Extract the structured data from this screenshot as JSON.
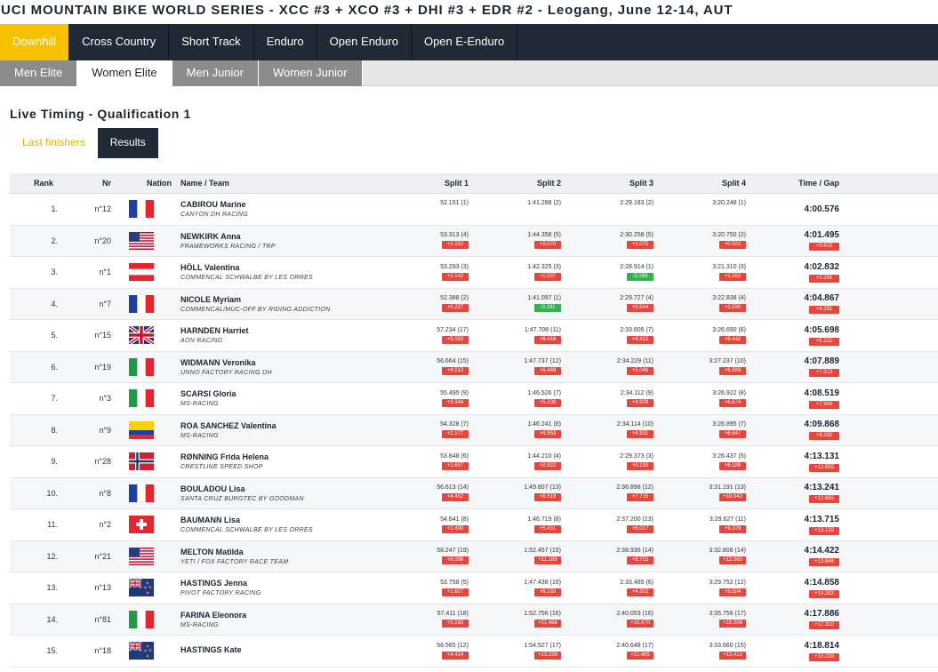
{
  "event_title": "UCI MOUNTAIN BIKE WORLD SERIES - XCC #3 + XCO #3 + DHI #3 + EDR #2 - Leogang, June 12-14, AUT",
  "discipline_tabs": [
    "Downhill",
    "Cross Country",
    "Short Track",
    "Enduro",
    "Open Enduro",
    "Open E-Enduro"
  ],
  "category_tabs": [
    "Men Elite",
    "Women Elite",
    "Men Junior",
    "Women Junior"
  ],
  "section_title": "Live Timing - Qualification 1",
  "sub_tabs": [
    "Last finishers",
    "Results"
  ],
  "table_headers": {
    "rank": "Rank",
    "nr": "Nr",
    "nation": "Nation",
    "name": "Name / Team",
    "split1": "Split 1",
    "split2": "Split 2",
    "split3": "Split 3",
    "split4": "Split 4",
    "time": "Time / Gap"
  },
  "colors": {
    "accent": "#f6c200",
    "nav_dark": "#1f2a36",
    "gap_red": "#e8453c",
    "gap_green": "#2fb34a"
  },
  "riders": [
    {
      "rank": "1.",
      "nr": "n°12",
      "nation": "FRA",
      "name": "CABIROU Marine",
      "team": "CANYON DH RACING",
      "s1": "52.151 (1)",
      "g1": "",
      "s2": "1:41.288 (2)",
      "g2": "",
      "s3": "2:29.183 (2)",
      "g3": "",
      "s4": "3:20.248 (1)",
      "g4": "",
      "time": "4:00.576",
      "gap": ""
    },
    {
      "rank": "2.",
      "nr": "n°20",
      "nation": "USA",
      "name": "NEWKIRK Anna",
      "team": "FRAMEWORKS RACING / TRP",
      "s1": "53.313 (4)",
      "g1": "+1.162",
      "s2": "1:44.358 (5)",
      "g2": "+3.070",
      "s3": "2:30.258 (5)",
      "g3": "+1.075",
      "s4": "3:20.750 (2)",
      "g4": "+0.502",
      "time": "4:01.495",
      "gap": "+0.919"
    },
    {
      "rank": "3.",
      "nr": "n°1",
      "nation": "AUT",
      "name": "HÖLL Valentina",
      "team": "COMMENCAL SCHWALBE BY LES ORRES",
      "s1": "53.293 (3)",
      "g1": "+1.142",
      "s2": "1:42.325 (3)",
      "g2": "+1.037",
      "s3": "2:28.914 (1)",
      "g3": "-0.269",
      "s4": "3:21.310 (3)",
      "g4": "+1.062",
      "time": "4:02.832",
      "gap": "+2.256"
    },
    {
      "rank": "4.",
      "nr": "n°7",
      "nation": "FRA",
      "name": "NICOLE Myriam",
      "team": "COMMENCAL/MUC-OFF BY RIDING ADDICTION",
      "s1": "52.388 (2)",
      "g1": "+0.237",
      "s2": "1:41.097 (1)",
      "g2": "-0.191",
      "s3": "2:29.727 (4)",
      "g3": "+0.544",
      "s4": "3:22.838 (4)",
      "g4": "+2.590",
      "time": "4:04.867",
      "gap": "+4.291"
    },
    {
      "rank": "5.",
      "nr": "n°15",
      "nation": "GBR",
      "name": "HARNDEN Harriet",
      "team": "AON RACING",
      "s1": "57.234 (17)",
      "g1": "+5.083",
      "s2": "1:47.706 (11)",
      "g2": "+6.418",
      "s3": "2:33.605 (7)",
      "g3": "+4.422",
      "s4": "3:26.690 (6)",
      "g4": "+6.442",
      "time": "4:05.698",
      "gap": "+5.122"
    },
    {
      "rank": "6.",
      "nr": "n°19",
      "nation": "ITA",
      "name": "WIDMANN Veronika",
      "team": "UNNO FACTORY RACING DH",
      "s1": "56.664 (15)",
      "g1": "+4.513",
      "s2": "1:47.737 (12)",
      "g2": "+6.449",
      "s3": "2:34.229 (11)",
      "g3": "+5.046",
      "s4": "3:27.237 (10)",
      "g4": "+6.989",
      "time": "4:07.889",
      "gap": "+7.313"
    },
    {
      "rank": "7.",
      "nr": "n°3",
      "nation": "ITA",
      "name": "SCARSI Gloria",
      "team": "MS-RACING",
      "s1": "55.495 (9)",
      "g1": "+3.344",
      "s2": "1:46.526 (7)",
      "g2": "+5.238",
      "s3": "2:34.112 (9)",
      "g3": "+4.929",
      "s4": "3:26.922 (8)",
      "g4": "+6.674",
      "time": "4:08.519",
      "gap": "+7.943"
    },
    {
      "rank": "8.",
      "nr": "n°9",
      "nation": "COL",
      "name": "ROA SANCHEZ Valentina",
      "team": "MS-RACING",
      "s1": "54.328 (7)",
      "g1": "+2.177",
      "s2": "1:46.241 (6)",
      "g2": "+4.953",
      "s3": "2:34.114 (10)",
      "g3": "+4.931",
      "s4": "3:26.895 (7)",
      "g4": "+6.647",
      "time": "4:09.868",
      "gap": "+9.292"
    },
    {
      "rank": "9.",
      "nr": "n°28",
      "nation": "NOR",
      "name": "RØNNING Frida Helena",
      "team": "CRESTLINE SPEED SHOP",
      "s1": "53.848 (6)",
      "g1": "+1.697",
      "s2": "1:44.210 (4)",
      "g2": "+2.922",
      "s3": "2:29.373 (3)",
      "g3": "+0.190",
      "s4": "3:26.437 (5)",
      "g4": "+6.189",
      "time": "4:13.131",
      "gap": "+12.555"
    },
    {
      "rank": "10.",
      "nr": "n°8",
      "nation": "FRA",
      "name": "BOULADOU Lisa",
      "team": "SANTA CRUZ BURGTEC BY GOODMAN",
      "s1": "56.613 (14)",
      "g1": "+4.462",
      "s2": "1:49.807 (13)",
      "g2": "+8.519",
      "s3": "2:36.898 (12)",
      "g3": "+7.715",
      "s4": "3:31.191 (13)",
      "g4": "+10.943",
      "time": "4:13.241",
      "gap": "+12.665"
    },
    {
      "rank": "11.",
      "nr": "n°2",
      "nation": "SUI",
      "name": "BAUMANN Lisa",
      "team": "COMMENCAL SCHWALBE BY LES ORRES",
      "s1": "54.641 (8)",
      "g1": "+2.490",
      "s2": "1:46.719 (8)",
      "g2": "+5.431",
      "s3": "2:37.200 (13)",
      "g3": "+8.017",
      "s4": "3:29.627 (11)",
      "g4": "+9.379",
      "time": "4:13.715",
      "gap": "+13.139"
    },
    {
      "rank": "12.",
      "nr": "n°21",
      "nation": "USA",
      "name": "MELTON Matilda",
      "team": "YETI / FOX FACTORY RACE TEAM",
      "s1": "58.247 (19)",
      "g1": "+6.096",
      "s2": "1:52.457 (15)",
      "g2": "+11.169",
      "s3": "2:38.936 (14)",
      "g3": "+9.753",
      "s4": "3:32.808 (14)",
      "g4": "+12.560",
      "time": "4:14.422",
      "gap": "+13.846"
    },
    {
      "rank": "13.",
      "nr": "n°13",
      "nation": "NZL",
      "name": "HASTINGS Jenna",
      "team": "PIVOT FACTORY RACING",
      "s1": "53.758 (5)",
      "g1": "+1.607",
      "s2": "1:47.438 (10)",
      "g2": "+6.150",
      "s3": "2:33.485 (6)",
      "g3": "+4.302",
      "s4": "3:29.752 (12)",
      "g4": "+9.504",
      "time": "4:14.858",
      "gap": "+14.282"
    },
    {
      "rank": "14.",
      "nr": "n°81",
      "nation": "ITA",
      "name": "FARINA Eleonora",
      "team": "MS-RACING",
      "s1": "57.411 (18)",
      "g1": "+5.260",
      "s2": "1:52.756 (16)",
      "g2": "+11.468",
      "s3": "2:40.053 (16)",
      "g3": "+10.870",
      "s4": "3:35.756 (17)",
      "g4": "+15.508",
      "time": "4:17.886",
      "gap": "+17.310"
    },
    {
      "rank": "15.",
      "nr": "n°18",
      "nation": "NZL",
      "name": "HASTINGS Kate",
      "team": "",
      "s1": "56.565 (12)",
      "g1": "+4.414",
      "s2": "1:54.527 (17)",
      "g2": "+13.239",
      "s3": "2:40.648 (17)",
      "g3": "+11.465",
      "s4": "3:33.660 (15)",
      "g4": "+13.412",
      "time": "4:18.814",
      "gap": "+18.238"
    }
  ]
}
